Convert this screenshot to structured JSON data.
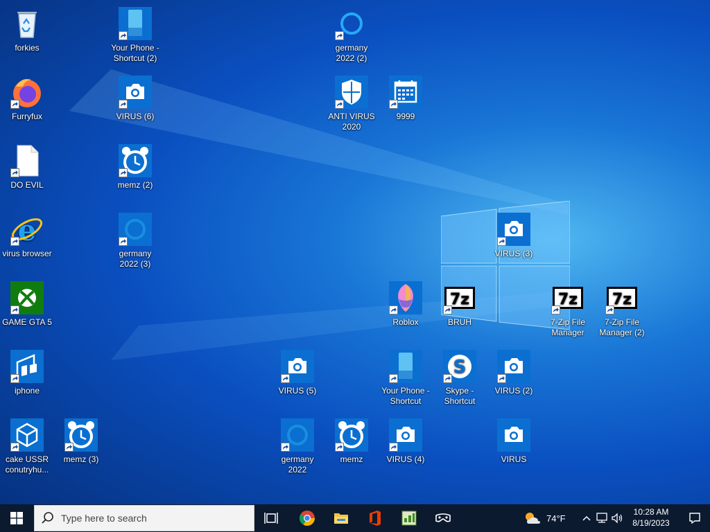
{
  "desktop": {
    "icons": [
      {
        "label": "forkies",
        "icon": "recycle-bin-icon"
      },
      {
        "label": "Your Phone - Shortcut (2)",
        "icon": "your-phone-icon"
      },
      {
        "label": "germany 2022 (2)",
        "icon": "cortana-icon"
      },
      {
        "label": "Furryfux",
        "icon": "firefox-icon"
      },
      {
        "label": "VIRUS (6)",
        "icon": "camera-icon"
      },
      {
        "label": "ANTI VIRUS 2020",
        "icon": "defender-shield-icon"
      },
      {
        "label": "9999",
        "icon": "calendar-icon"
      },
      {
        "label": "DO EVIL",
        "icon": "blank-file-icon"
      },
      {
        "label": "memz (2)",
        "icon": "alarm-clock-icon"
      },
      {
        "label": "virus browser",
        "icon": "internet-explorer-icon"
      },
      {
        "label": "germany 2022 (3)",
        "icon": "cortana-icon"
      },
      {
        "label": "VIRUS (3)",
        "icon": "camera-icon"
      },
      {
        "label": "GAME GTA 5",
        "icon": "xbox-icon"
      },
      {
        "label": "Roblox",
        "icon": "paint3d-icon"
      },
      {
        "label": "BRUH",
        "icon": "7zip-icon"
      },
      {
        "label": "7-Zip File Manager",
        "icon": "7zip-icon"
      },
      {
        "label": "7-Zip File Manager (2)",
        "icon": "7zip-icon"
      },
      {
        "label": "iphone",
        "icon": "tablet-mode-icon"
      },
      {
        "label": "VIRUS (5)",
        "icon": "camera-icon"
      },
      {
        "label": "Your Phone - Shortcut",
        "icon": "your-phone-icon"
      },
      {
        "label": "Skype - Shortcut",
        "icon": "skype-icon"
      },
      {
        "label": "VIRUS (2)",
        "icon": "camera-icon"
      },
      {
        "label": "cake USSR conutryhu...",
        "icon": "3d-viewer-icon"
      },
      {
        "label": "memz (3)",
        "icon": "alarm-clock-icon"
      },
      {
        "label": "germany 2022",
        "icon": "cortana-icon"
      },
      {
        "label": "memz",
        "icon": "alarm-clock-icon"
      },
      {
        "label": "VIRUS (4)",
        "icon": "camera-icon"
      },
      {
        "label": "VIRUS",
        "icon": "camera-icon"
      }
    ]
  },
  "taskbar": {
    "search_placeholder": "Type here to search",
    "pinned": [
      "task-view-icon",
      "chrome-icon",
      "file-explorer-icon",
      "office-icon",
      "green-app-icon",
      "mixed-reality-icon"
    ],
    "weather_temp": "74°F",
    "time": "10:28 AM",
    "date": "8/19/2023"
  },
  "colors": {
    "taskbar": "#0b1a2f",
    "accent": "#0078d7"
  }
}
